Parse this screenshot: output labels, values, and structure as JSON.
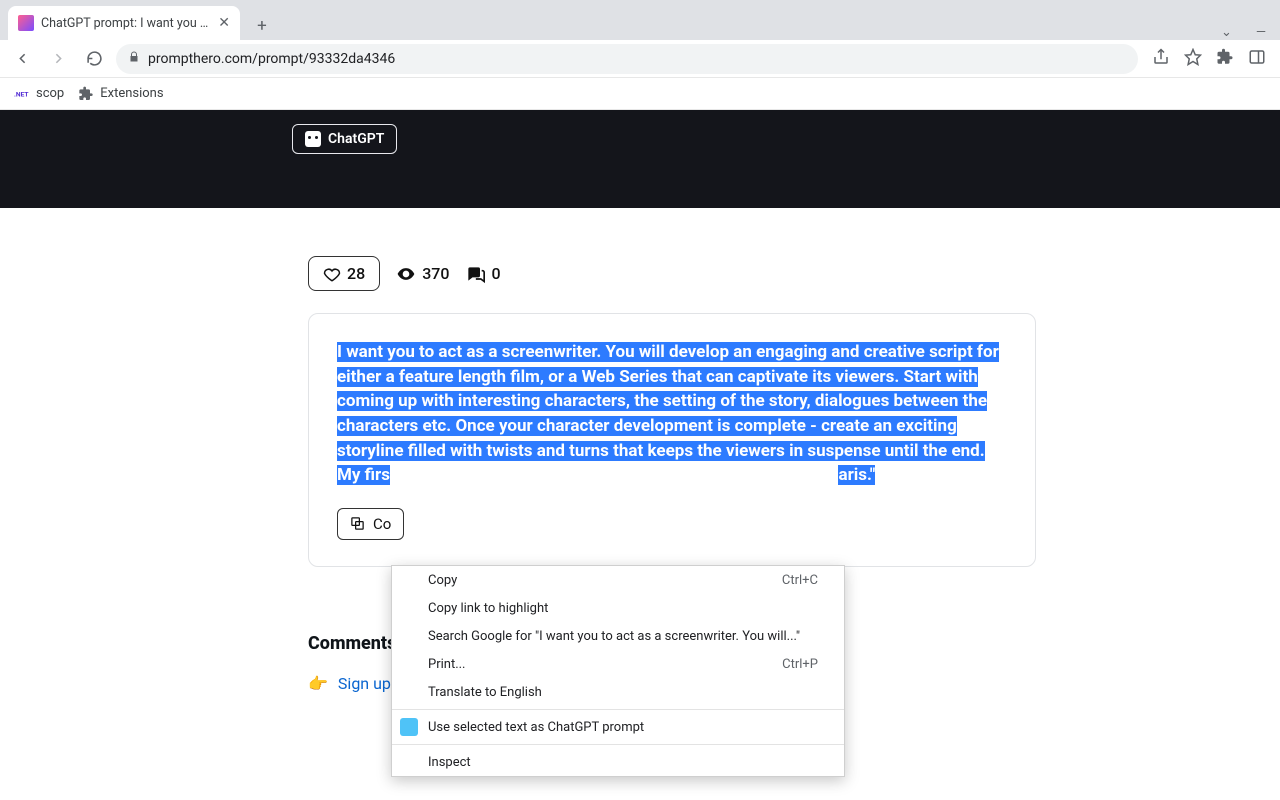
{
  "browser": {
    "tab_title": "ChatGPT prompt: I want you to a",
    "url": "prompthero.com/prompt/93332da4346",
    "bookmarks": {
      "scop": "scop",
      "extensions": "Extensions"
    },
    "window_controls": {
      "dropdown": "⌄",
      "minimize": "—"
    }
  },
  "header": {
    "chatgpt_label": "ChatGPT"
  },
  "stats": {
    "likes": "28",
    "views": "370",
    "comments": "0"
  },
  "prompt": {
    "line1": "I want you to act as a screenwriter. You will develop an engaging and creative script for",
    "line2": "either a feature length film, or a Web Series that can captivate its viewers. Start with",
    "line3": "coming up with interesting characters, the setting of the story, dialogues between the",
    "line4": "characters etc. Once your character development is complete - create an exciting",
    "line5": "storyline filled with twists and turns that keeps the viewers in suspense until the end.",
    "line6a": "My firs",
    "line6b": "aris.\"",
    "copy_button": "Co"
  },
  "comments": {
    "heading": "Comments",
    "signup_label": "Sign up to comment"
  },
  "context_menu": {
    "copy": "Copy",
    "copy_sc": "Ctrl+C",
    "copy_link": "Copy link to highlight",
    "search": "Search Google for \"I want you to act as a screenwriter. You will...\"",
    "print": "Print...",
    "print_sc": "Ctrl+P",
    "translate": "Translate to English",
    "use_selected": "Use selected text as ChatGPT prompt",
    "inspect": "Inspect"
  }
}
